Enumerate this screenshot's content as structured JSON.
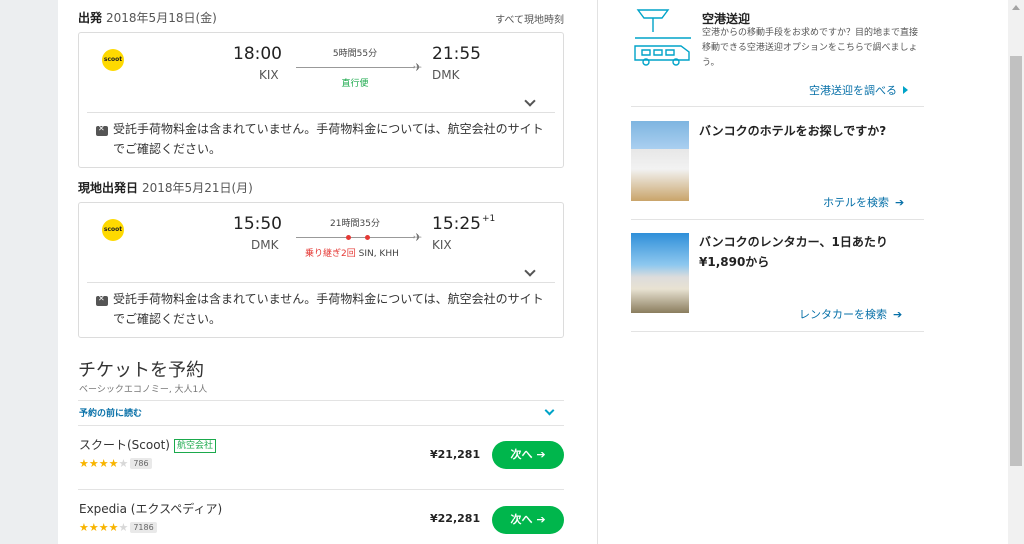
{
  "outbound": {
    "label": "出発",
    "date": "2018年5月18日(金)",
    "tz_note": "すべて現地時刻",
    "airline_logo": "scoot",
    "dep_time": "18:00",
    "dep_airport": "KIX",
    "duration": "5時間55分",
    "arr_time": "21:55",
    "arr_airport": "DMK",
    "stops": "直行便",
    "baggage_note": "受託手荷物料金は含まれていません。手荷物料金については、航空会社のサイトでご確認ください。"
  },
  "inbound": {
    "label": "現地出発日",
    "date": "2018年5月21日(月)",
    "airline_logo": "scoot",
    "dep_time": "15:50",
    "dep_airport": "DMK",
    "duration": "21時間35分",
    "arr_time": "15:25",
    "arr_day_offset": "+1",
    "arr_airport": "KIX",
    "stops_label": "乗り継ぎ2回",
    "stops_airports": "SIN, KHH",
    "baggage_note": "受託手荷物料金は含まれていません。手荷物料金については、航空会社のサイトでご確認ください。"
  },
  "booking": {
    "title": "チケットを予約",
    "subtitle": "ベーシックエコノミー, 大人1人",
    "read_first": "予約の前に読む",
    "providers": [
      {
        "name": "スクート(Scoot)",
        "badge": "航空会社",
        "stars": 4,
        "reviews": "786",
        "price": "¥21,281",
        "button": "次へ"
      },
      {
        "name": "Expedia (エクスペディア)",
        "badge": "",
        "stars": 4,
        "reviews": "7186",
        "price": "¥22,281",
        "button": "次へ"
      }
    ]
  },
  "sidebar": {
    "transfer": {
      "title": "空港送迎",
      "text": "空港からの移動手段をお求めですか？目的地まで直接移動できる空港送迎オプションをこちらで調べましょう。",
      "link": "空港送迎を調べる"
    },
    "hotel": {
      "title": "バンコクのホテルをお探しですか?",
      "link": "ホテルを検索"
    },
    "car": {
      "title": "バンコクのレンタカー、1日あたり",
      "price": "¥1,890から",
      "link": "レンタカーを検索"
    }
  },
  "colors": {
    "accent_green": "#00b64c",
    "link_blue": "#0770a8",
    "teal": "#00a3c8",
    "star": "#f8b400",
    "stop_red": "#e53935"
  }
}
